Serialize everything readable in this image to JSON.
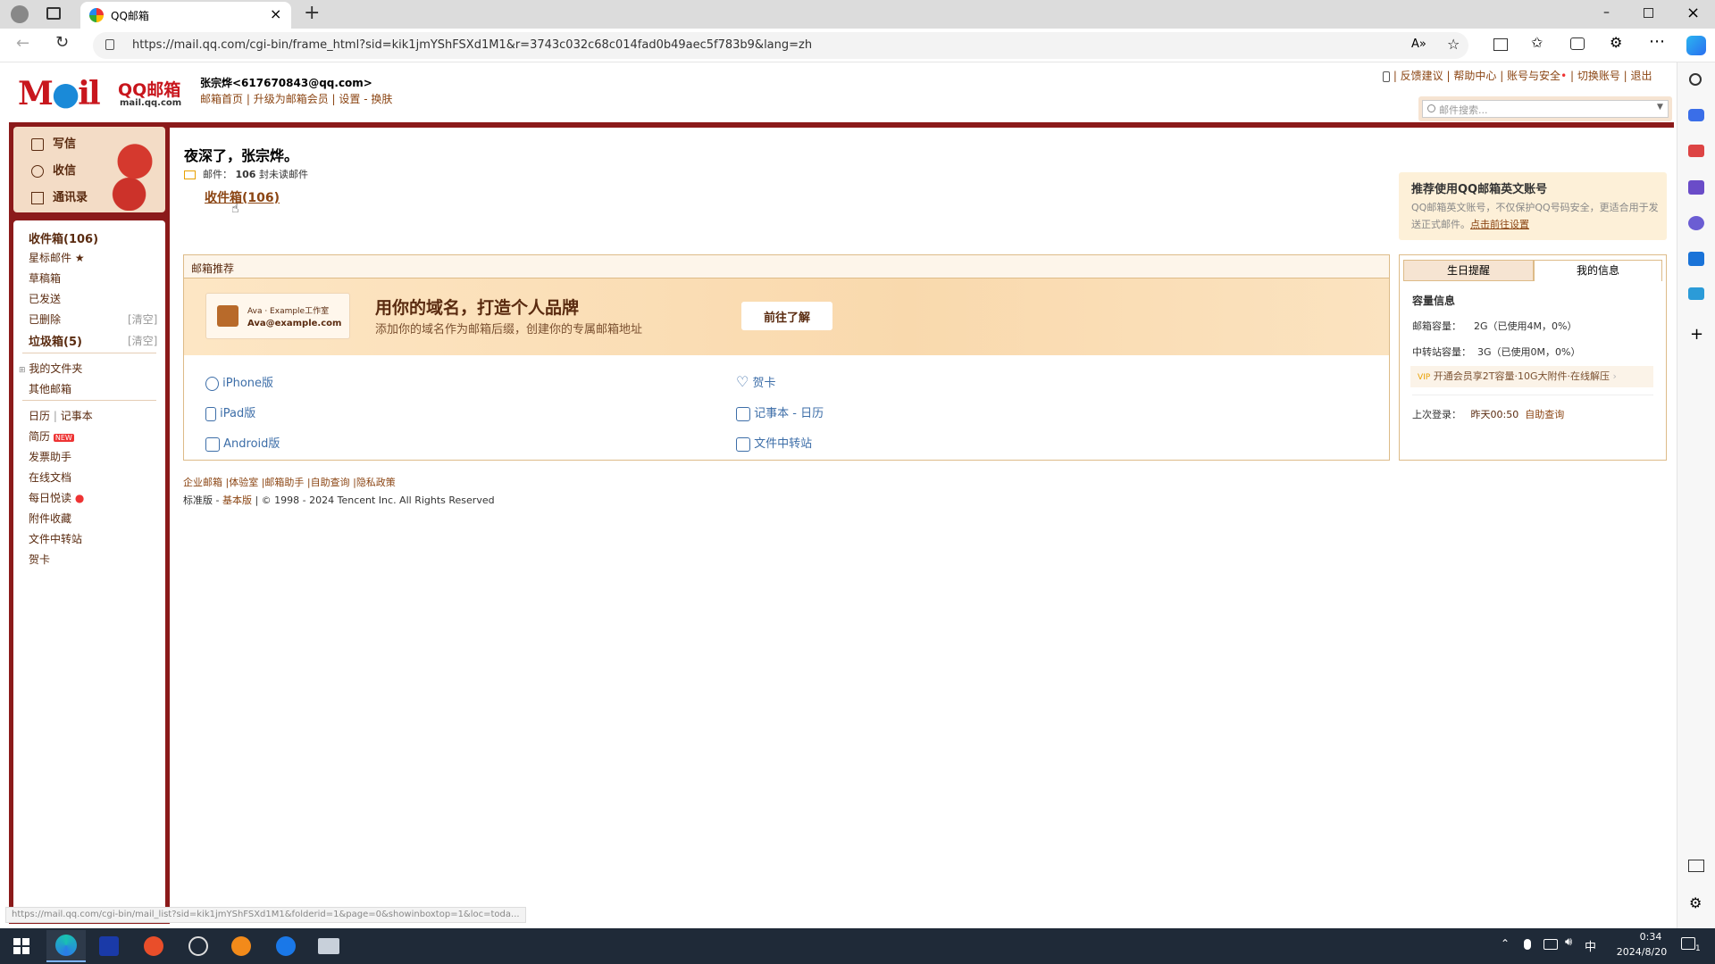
{
  "browser": {
    "tab_title": "QQ邮箱",
    "url": "https://mail.qq.com/cgi-bin/frame_html?sid=kik1jmYShFSXd1M1&r=3743c032c68c014fad0b49aec5f783b9&lang=zh",
    "status_url": "https://mail.qq.com/cgi-bin/mail_list?sid=kik1jmYShFSXd1M1&folderid=1&page=0&showinboxtop=1&loc=toda..."
  },
  "header": {
    "logo_text": "QQ邮箱",
    "logo_sub": "mail.qq.com",
    "user": "张宗烨<617670843@qq.com>",
    "links": [
      "邮箱首页",
      "升级为邮箱会员",
      "设置",
      "换肤"
    ],
    "top_links": [
      "反馈建议",
      "帮助中心",
      "账号与安全",
      "切换账号",
      "退出"
    ],
    "search_placeholder": "邮件搜索..."
  },
  "nav": {
    "compose": "写信",
    "receive": "收信",
    "contacts": "通讯录",
    "folders": [
      {
        "label": "收件箱(106)",
        "bold": true
      },
      {
        "label": "星标邮件 ★"
      },
      {
        "label": "草稿箱"
      },
      {
        "label": "已发送"
      },
      {
        "label": "已删除",
        "action": "[清空]"
      },
      {
        "label": "垃圾箱(5)",
        "bold": true,
        "action": "[清空]"
      }
    ],
    "my_folders": "我的文件夹",
    "other": "其他邮箱",
    "calendar": "日历",
    "notes": "记事本",
    "tools": [
      "简历",
      "发票助手",
      "在线文档",
      "每日悦读",
      "附件收藏",
      "文件中转站",
      "贺卡"
    ],
    "new_badge": "NEW"
  },
  "welcome": {
    "greeting": "夜深了，张宗烨。",
    "mail_label": "邮件：",
    "mail_count": "106",
    "mail_suffix": "封未读邮件",
    "inbox_link": "收件箱(106)"
  },
  "recommend": {
    "title": "推荐使用QQ邮箱英文账号",
    "desc": "QQ邮箱英文账号，不仅保护QQ号码安全，更适合用于发送正式邮件。",
    "link": "点击前往设置"
  },
  "promo": {
    "section_title": "邮箱推荐",
    "card_line1": "Ava · Example工作室",
    "card_line2": "Ava@example.com",
    "headline": "用你的域名，打造个人品牌",
    "sub": "添加你的域名作为邮箱后缀，创建你的专属邮箱地址",
    "button": "前往了解",
    "apps": [
      "iPhone版",
      "iPad版",
      "Android版",
      "贺卡",
      "记事本 - 日历",
      "文件中转站"
    ]
  },
  "info": {
    "tabs": [
      "生日提醒",
      "我的信息"
    ],
    "capacity_title": "容量信息",
    "mail_cap_label": "邮箱容量：",
    "mail_cap": "2G（已使用4M，0%）",
    "transfer_cap_label": "中转站容量：",
    "transfer_cap": "3G（已使用0M，0%）",
    "vip": "开通会员享2T容量·10G大附件·在线解压",
    "last_login_label": "上次登录：",
    "last_login": "昨天00:50",
    "self_query": "自助查询"
  },
  "footer": {
    "links": [
      "企业邮箱",
      "体验室",
      "邮箱助手",
      "自助查询",
      "隐私政策"
    ],
    "line2a": "标准版",
    "line2b": "基本版",
    "copyright": "© 1998 - 2024 Tencent Inc. All Rights Reserved"
  },
  "taskbar": {
    "time": "0:34",
    "date": "2024/8/20",
    "ime": "中",
    "notif": "1"
  },
  "colors": {
    "brand_red": "#8b1a1a",
    "link_brown": "#8b4513",
    "promo_bg": "#fde6c4"
  }
}
